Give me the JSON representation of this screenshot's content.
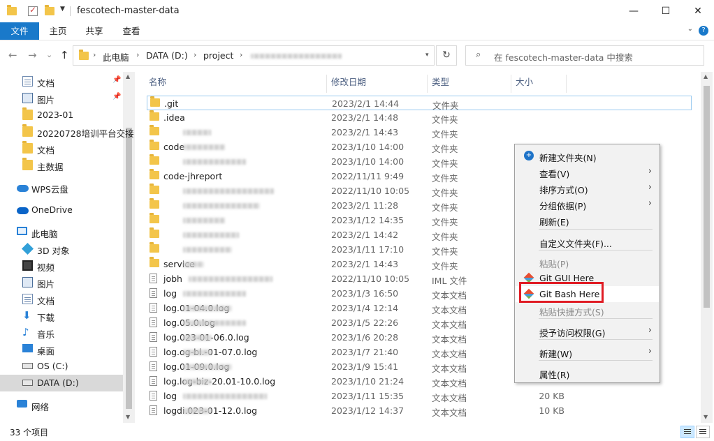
{
  "window": {
    "title": "fescotech-master-data",
    "minimize": "—",
    "maximize": "☐",
    "close": "✕"
  },
  "ribbon": {
    "tabs": [
      "文件",
      "主页",
      "共享",
      "查看"
    ],
    "expand": "⌄",
    "help": "?"
  },
  "nav": {
    "back": "←",
    "forward": "→",
    "recent": "⌄",
    "up": "↑",
    "breadcrumb": [
      "此电脑",
      "DATA (D:)",
      "project"
    ],
    "separator": "›",
    "refresh": "↻",
    "search_placeholder": "在 fescotech-master-data 中搜索",
    "search_icon": "⌕"
  },
  "sidebar": {
    "items": [
      {
        "label": "文档",
        "icon": "document-icon",
        "pinned": true
      },
      {
        "label": "图片",
        "icon": "picture-icon",
        "pinned": true
      },
      {
        "label": "2023-01",
        "icon": "folder-icon"
      },
      {
        "label": "20220728培训平台交接",
        "icon": "folder-icon"
      },
      {
        "label": "文档",
        "icon": "folder-icon"
      },
      {
        "label": "主数据",
        "icon": "folder-icon"
      },
      {
        "label": "WPS云盘",
        "icon": "cloud-icon"
      },
      {
        "label": "OneDrive",
        "icon": "onedrive-icon"
      },
      {
        "label": "此电脑",
        "icon": "computer-icon"
      },
      {
        "label": "3D 对象",
        "icon": "3d-objects-icon"
      },
      {
        "label": "视频",
        "icon": "video-icon"
      },
      {
        "label": "图片",
        "icon": "picture-icon"
      },
      {
        "label": "文档",
        "icon": "document-icon"
      },
      {
        "label": "下载",
        "icon": "download-icon"
      },
      {
        "label": "音乐",
        "icon": "music-icon"
      },
      {
        "label": "桌面",
        "icon": "desktop-icon"
      },
      {
        "label": "OS (C:)",
        "icon": "drive-icon"
      },
      {
        "label": "DATA (D:)",
        "icon": "drive-icon",
        "selected": true
      },
      {
        "label": "网络",
        "icon": "network-icon"
      }
    ],
    "pin_glyph": "📌"
  },
  "columns": {
    "name": "名称",
    "date": "修改日期",
    "type": "类型",
    "size": "大小"
  },
  "files": [
    {
      "name": ".git",
      "date": "2023/2/1 14:44",
      "type": "文件夹",
      "size": "",
      "kind": "folder"
    },
    {
      "name": ".idea",
      "date": "2023/2/1 14:48",
      "type": "文件夹",
      "size": "",
      "kind": "folder"
    },
    {
      "name": "",
      "date": "2023/2/1 14:43",
      "type": "文件夹",
      "size": "",
      "kind": "folder"
    },
    {
      "name": "code",
      "date": "2023/1/10 14:00",
      "type": "文件夹",
      "size": "",
      "kind": "folder"
    },
    {
      "name": "",
      "date": "2023/1/10 14:00",
      "type": "文件夹",
      "size": "",
      "kind": "folder"
    },
    {
      "name": "code-jhreport",
      "date": "2022/11/11 9:49",
      "type": "文件夹",
      "size": "",
      "kind": "folder"
    },
    {
      "name": "",
      "date": "2022/11/10 10:05",
      "type": "文件夹",
      "size": "",
      "kind": "folder"
    },
    {
      "name": "",
      "date": "2023/2/1 11:28",
      "type": "文件夹",
      "size": "",
      "kind": "folder"
    },
    {
      "name": "",
      "date": "2023/1/12 14:35",
      "type": "文件夹",
      "size": "",
      "kind": "folder"
    },
    {
      "name": "",
      "date": "2023/2/1 14:42",
      "type": "文件夹",
      "size": "",
      "kind": "folder"
    },
    {
      "name": "",
      "date": "2023/1/11 17:10",
      "type": "文件夹",
      "size": "",
      "kind": "folder"
    },
    {
      "name": "service",
      "date": "2023/2/1 14:43",
      "type": "文件夹",
      "size": "",
      "kind": "folder"
    },
    {
      "name": "jobh",
      "date": "2022/11/10 10:05",
      "type": "IML 文件",
      "size": "",
      "kind": "file"
    },
    {
      "name": "log",
      "date": "2023/1/3 16:50",
      "type": "文本文档",
      "size": "",
      "kind": "file"
    },
    {
      "name": "log.01-04.0.log",
      "date": "2023/1/4 12:14",
      "type": "文本文档",
      "size": "",
      "kind": "file"
    },
    {
      "name": "log.05.0.log",
      "date": "2023/1/5 22:26",
      "type": "文本文档",
      "size": "",
      "kind": "file"
    },
    {
      "name": "log.023-01-06.0.log",
      "date": "2023/1/6 20:28",
      "type": "文本文档",
      "size": "",
      "kind": "file"
    },
    {
      "name": "log.og-bi.-01-07.0.log",
      "date": "2023/1/7 21:40",
      "type": "文本文档",
      "size": "",
      "kind": "file"
    },
    {
      "name": "log.01-09.0.log",
      "date": "2023/1/9 15:41",
      "type": "文本文档",
      "size": "",
      "kind": "file"
    },
    {
      "name": "log.log-biz-20.01-10.0.log",
      "date": "2023/1/10 21:24",
      "type": "文本文档",
      "size": "",
      "kind": "file"
    },
    {
      "name": "log",
      "date": "2023/1/11 15:35",
      "type": "文本文档",
      "size": "20 KB",
      "kind": "file"
    },
    {
      "name": "logdi.023-01-12.0.log",
      "date": "2023/1/12 14:37",
      "type": "文本文档",
      "size": "10 KB",
      "kind": "file"
    }
  ],
  "context_menu": {
    "items": [
      {
        "label": "新建文件夹(N)",
        "icon": "new-folder-icon",
        "disabled": false,
        "submenu": false
      },
      {
        "label": "查看(V)",
        "disabled": false,
        "submenu": true
      },
      {
        "label": "排序方式(O)",
        "disabled": false,
        "submenu": true
      },
      {
        "label": "分组依据(P)",
        "disabled": false,
        "submenu": true
      },
      {
        "label": "刷新(E)",
        "disabled": false,
        "submenu": false
      },
      {
        "label": "自定义文件夹(F)...",
        "disabled": false,
        "submenu": false
      },
      {
        "label": "粘贴(P)",
        "disabled": true,
        "submenu": false
      },
      {
        "label": "Git GUI Here",
        "icon": "git-icon",
        "disabled": false,
        "submenu": false
      },
      {
        "label": "Git Bash Here",
        "icon": "git-icon",
        "disabled": false,
        "submenu": false,
        "highlighted": true
      },
      {
        "label": "粘贴快捷方式(S)",
        "disabled": true,
        "submenu": false
      },
      {
        "label": "授予访问权限(G)",
        "disabled": false,
        "submenu": true
      },
      {
        "label": "新建(W)",
        "disabled": false,
        "submenu": true
      },
      {
        "label": "属性(R)",
        "disabled": false,
        "submenu": false
      }
    ],
    "arrow": "›",
    "highlight_color": "#e01c24"
  },
  "status": {
    "count": "33 个项目"
  }
}
